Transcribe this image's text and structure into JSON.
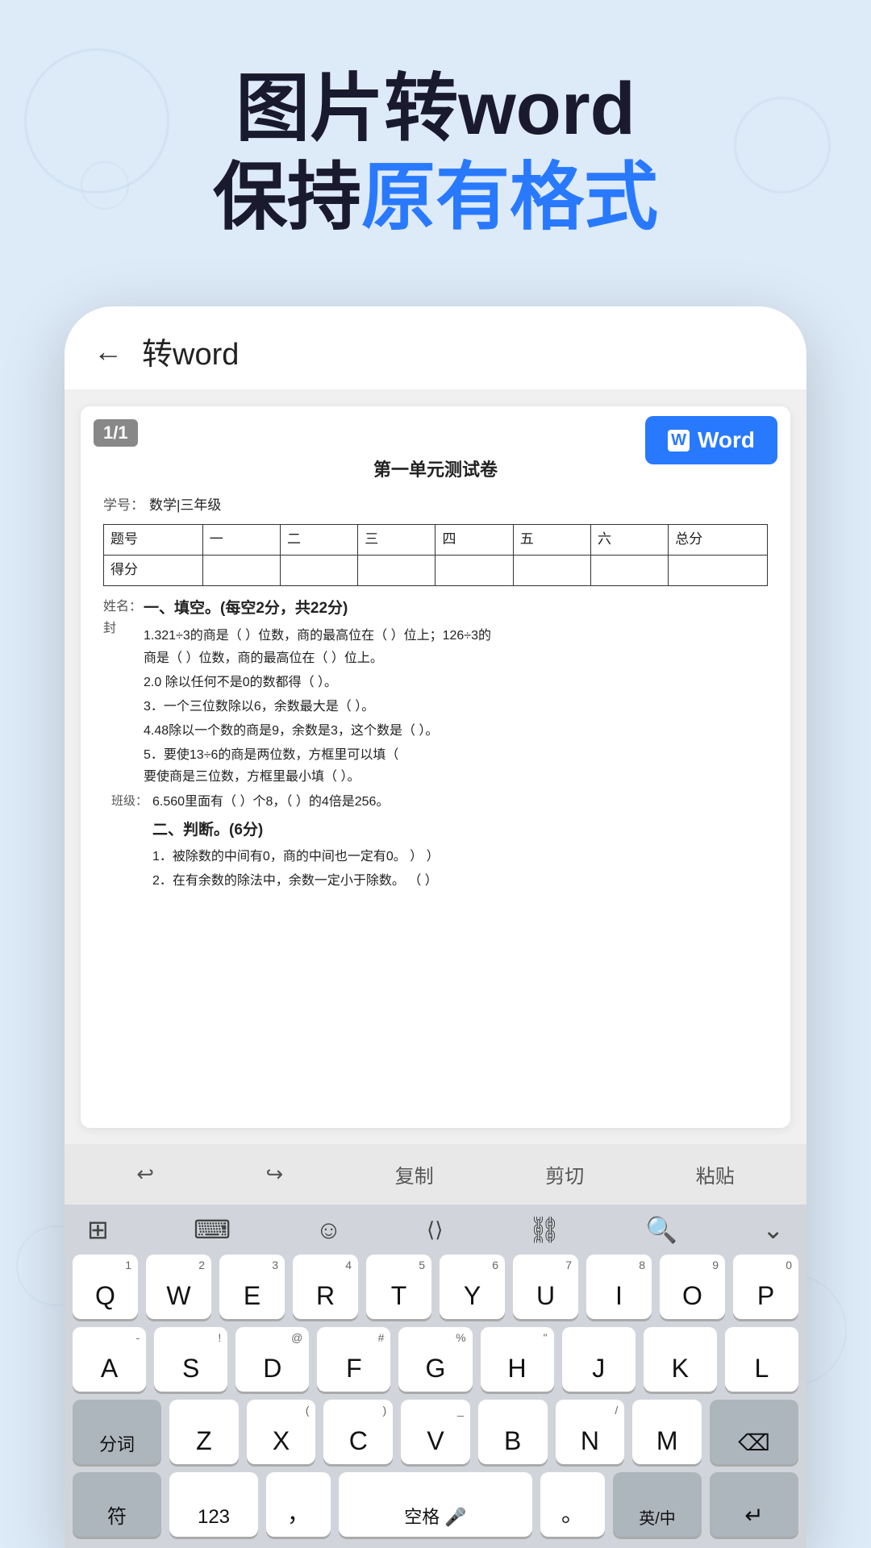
{
  "header": {
    "line1": "图片转word",
    "line2_prefix": "保持",
    "line2_highlight": "原有格式",
    "line2_suffix": ""
  },
  "topbar": {
    "back_label": "←",
    "title": "转word"
  },
  "viewer": {
    "page_badge": "1/1",
    "word_button": "Word",
    "doc_title": "第一单元测试卷",
    "meta_label": "学号：",
    "meta_value": "数学|三年级",
    "table_headers": [
      "题号",
      "一",
      "二",
      "三",
      "四",
      "五",
      "六",
      "总分"
    ],
    "table_row2": [
      "得分",
      "",
      "",
      "",
      "",
      "",
      "",
      ""
    ],
    "section1": "一、填空。(每空2分，共22分)",
    "items": [
      "1.321÷3的商是（ ）位数，商的最高位在（ ）位上；126÷3的\n商是（ ）位数，商的最高位在（ ）位上。",
      "2.0 除以任何不是0的数都得（ ）。",
      "3．一个三位数除以6，余数最大是（ ）。",
      "4.48除以一个数的商是9，余数是3，这个数是（ ）。",
      "5．要使13÷6的商是两位数，方框里可以填（\n要使商是三位数，方框里最小填（ ）。",
      "6.560里面有（ ）个8，（ ）的4倍是256。"
    ],
    "section2": "二、判断。(6分)",
    "judge_items": [
      "1．被除数的中间有0，商的中间也一定有0。   ）           ）",
      "2．在有余数的除法中，余数一定小于除数。  （ ）"
    ],
    "name_label": "姓名：",
    "name_value": "封",
    "class_label": "班级："
  },
  "toolbar": {
    "undo": "↩",
    "redo": "↪",
    "copy": "复制",
    "cut": "剪切",
    "paste": "粘贴"
  },
  "keyboard": {
    "top_icons": [
      "⊞",
      "⌨",
      "☺",
      "</>",
      "⛓",
      "🔍",
      "⌄"
    ],
    "row1": [
      {
        "main": "Q",
        "sub": "1"
      },
      {
        "main": "W",
        "sub": "2"
      },
      {
        "main": "E",
        "sub": "3"
      },
      {
        "main": "R",
        "sub": "4"
      },
      {
        "main": "T",
        "sub": "5"
      },
      {
        "main": "Y",
        "sub": "6"
      },
      {
        "main": "U",
        "sub": "7"
      },
      {
        "main": "I",
        "sub": "8"
      },
      {
        "main": "O",
        "sub": "9"
      },
      {
        "main": "P",
        "sub": "0"
      }
    ],
    "row2": [
      {
        "main": "A",
        "sub": "-"
      },
      {
        "main": "S",
        "sub": "!"
      },
      {
        "main": "D",
        "sub": "@"
      },
      {
        "main": "F",
        "sub": "#"
      },
      {
        "main": "G",
        "sub": "%"
      },
      {
        "main": "H",
        "sub": "\""
      },
      {
        "main": "J",
        "sub": ""
      },
      {
        "main": "K",
        "sub": ""
      },
      {
        "main": "L",
        "sub": ""
      }
    ],
    "row3_left": "分词",
    "row3": [
      {
        "main": "Z",
        "sub": ""
      },
      {
        "main": "X",
        "sub": "("
      },
      {
        "main": "C",
        "sub": ")"
      },
      {
        "main": "V",
        "sub": "_"
      },
      {
        "main": "B",
        "sub": ""
      },
      {
        "main": "N",
        "sub": "/"
      },
      {
        "main": "M",
        "sub": ""
      }
    ],
    "row3_right": "⌫",
    "bottom_left1": "符",
    "bottom_left2": "123",
    "bottom_comma": "，",
    "bottom_space": "空格",
    "bottom_period": "。",
    "bottom_lang": "英/中",
    "bottom_enter": "↵"
  }
}
